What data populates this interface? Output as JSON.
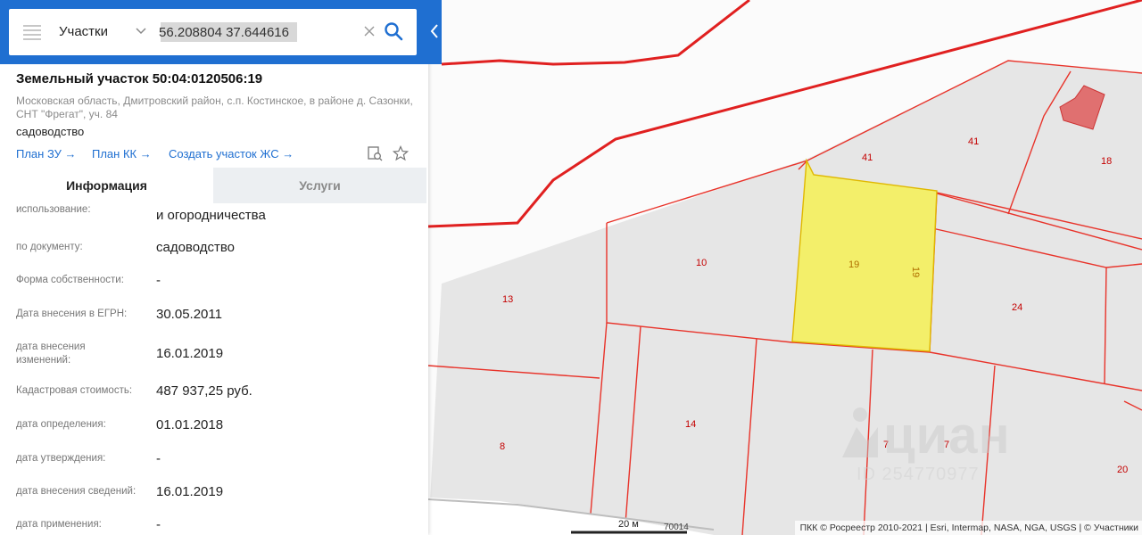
{
  "search": {
    "category": "Участки",
    "query": "56.208804 37.644616"
  },
  "plot": {
    "title": "Земельный участок 50:04:0120506:19",
    "address": "Московская область, Дмитровский район, с.п. Костинское, в районе д. Сазонки, СНТ \"Фрегат\", уч. 84",
    "use": "садоводство"
  },
  "links": {
    "plan_zu": "План ЗУ →",
    "plan_kk": "План КК →",
    "create": "Создать участок ЖС →"
  },
  "tabs": {
    "info": "Информация",
    "services": "Услуги"
  },
  "rows": [
    {
      "label": "использование:",
      "value": "и огородничества"
    },
    {
      "label": "по документу:",
      "value": "садоводство"
    },
    {
      "label": "Форма собственности:",
      "value": "-"
    },
    {
      "label": "Дата внесения в ЕГРН:",
      "value": "30.05.2011"
    },
    {
      "label": "дата внесения изменений:",
      "value": "16.01.2019"
    },
    {
      "label": "Кадастровая стоимость:",
      "value": "487 937,25 руб."
    },
    {
      "label": "дата определения:",
      "value": "01.01.2018"
    },
    {
      "label": "дата утверждения:",
      "value": "-"
    },
    {
      "label": "дата внесения сведений:",
      "value": "16.01.2019"
    },
    {
      "label": "дата применения:",
      "value": "-"
    }
  ],
  "map": {
    "plot_labels": [
      "41",
      "41",
      "18",
      "10",
      "19",
      "19",
      "13",
      "24",
      "14",
      "8",
      "7",
      "7",
      "20"
    ],
    "scale": "20 м",
    "road": "70014",
    "attribution": "ПКК © Росреестр 2010-2021 | Esri, Intermap, NASA, NGA, USGS | © Участники",
    "watermark": "циан",
    "watermark_id": "ID 254770977"
  },
  "colors": {
    "accent": "#1f6fd1",
    "boundary": "#e02020",
    "selected_plot": "#f3ef6a"
  }
}
